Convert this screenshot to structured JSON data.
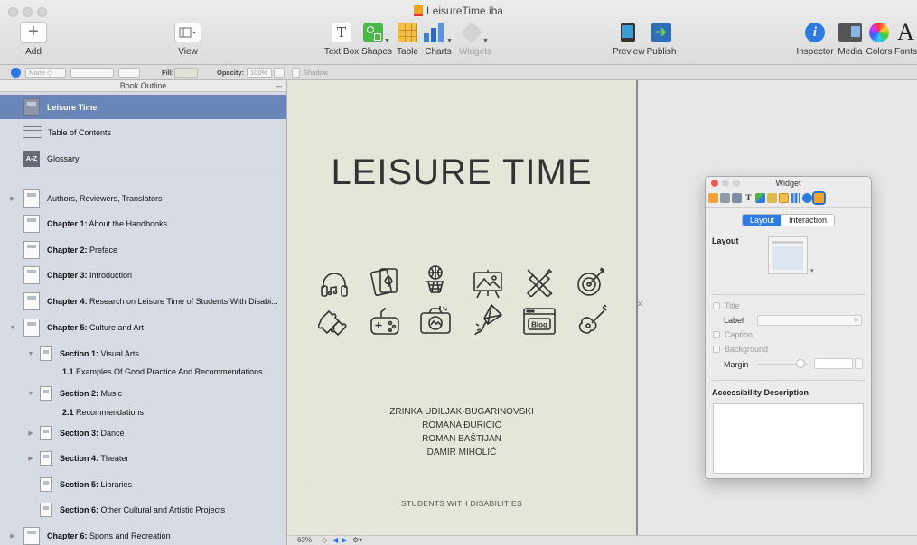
{
  "window": {
    "title": "LeisureTime.iba"
  },
  "toolbar": {
    "add": "Add",
    "view": "View",
    "text_box": "Text Box",
    "shapes": "Shapes",
    "table": "Table",
    "charts": "Charts",
    "widgets": "Widgets",
    "preview": "Preview",
    "publish": "Publish",
    "inspector": "Inspector",
    "media": "Media",
    "colors": "Colors",
    "fonts": "Fonts"
  },
  "format_bar": {
    "stroke_value": "None",
    "fill_label": "Fill:",
    "opacity_label": "Opacity:",
    "opacity_value": "100%",
    "shadow_label": "Shadow"
  },
  "sidebar": {
    "header": "Book Outline",
    "items": [
      {
        "prefix": "",
        "label": "Leisure Time"
      },
      {
        "prefix": "",
        "label": "Table of Contents"
      },
      {
        "prefix": "",
        "label": "Glossary",
        "icon_text": "A-Z"
      },
      {
        "prefix": "",
        "label": "Authors, Reviewers, Translators"
      },
      {
        "prefix": "Chapter 1:",
        "label": " About the Handbooks"
      },
      {
        "prefix": "Chapter 2:",
        "label": " Preface"
      },
      {
        "prefix": "Chapter 3:",
        "label": " Introduction"
      },
      {
        "prefix": "Chapter 4:",
        "label": " Research on Leisure Time of Students With Disabi..."
      },
      {
        "prefix": "Chapter 5:",
        "label": " Culture and Art"
      },
      {
        "prefix": "Section 1:",
        "label": " Visual Arts"
      },
      {
        "prefix": "1.1",
        "label": " Examples Of Good Practice And Recommendations"
      },
      {
        "prefix": "Section 2:",
        "label": " Music"
      },
      {
        "prefix": "2.1",
        "label": " Recommendations"
      },
      {
        "prefix": "Section 3:",
        "label": " Dance"
      },
      {
        "prefix": "Section 4:",
        "label": " Theater"
      },
      {
        "prefix": "Section 5:",
        "label": " Libraries"
      },
      {
        "prefix": "Section 6:",
        "label": " Other Cultural and Artistic Projects"
      },
      {
        "prefix": "Chapter 6:",
        "label": " Sports and Recreation"
      }
    ]
  },
  "page": {
    "title": "LEISURE TIME",
    "blog_label": "Blog",
    "authors": [
      "ZRINKA UDILJAK-BUGARINOVSKI",
      "ROMANA ĐURIČIĆ",
      "ROMAN BAŠTIJAN",
      "DAMIR MIHOLIĆ"
    ],
    "subtitle": "STUDENTS WITH DISABILITIES"
  },
  "status": {
    "zoom": "63%"
  },
  "widget_inspector": {
    "title": "Widget",
    "tab_layout": "Layout",
    "tab_interaction": "Interaction",
    "layout_heading": "Layout",
    "title_check": "Title",
    "label_label": "Label",
    "caption_check": "Caption",
    "background_check": "Background",
    "margin_label": "Margin",
    "margin_level": 0.85,
    "accessibility_heading": "Accessibility Description"
  }
}
